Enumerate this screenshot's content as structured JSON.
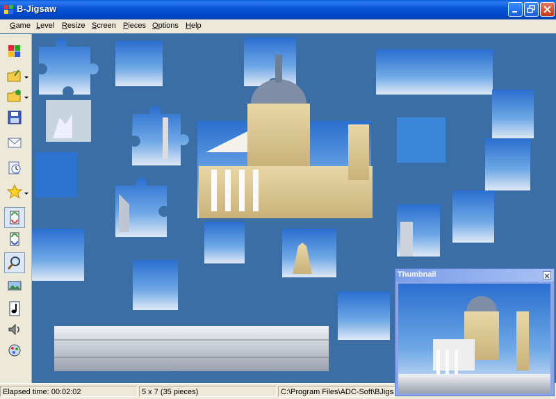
{
  "window": {
    "title": "B-Jigsaw"
  },
  "title_buttons": {
    "minimize": "minimize-icon",
    "maximize": "maximize-icon",
    "close": "close-icon"
  },
  "menu": {
    "items": [
      {
        "ul": "G",
        "rest": "ame"
      },
      {
        "ul": "L",
        "rest": "evel"
      },
      {
        "ul": "R",
        "rest": "esize"
      },
      {
        "ul": "S",
        "rest": "creen"
      },
      {
        "ul": "P",
        "rest": "ieces"
      },
      {
        "ul": "O",
        "rest": "ptions"
      },
      {
        "ul": "H",
        "rest": "elp"
      }
    ]
  },
  "toolbar": {
    "icons": [
      "puzzle-icon",
      "open-folder-icon",
      "open-recent-icon",
      "save-icon",
      "email-icon",
      "timer-icon",
      "favorites-star-icon",
      "shuffle-icon",
      "rotate-icon",
      "zoom-icon",
      "show-picture-icon",
      "music-icon",
      "sound-icon",
      "settings-icon"
    ]
  },
  "status": {
    "elapsed": "Elapsed time: 00:02:02",
    "size": "5 x 7 (35 pieces)",
    "path": "C:\\Program Files\\ADC-Soft\\BJigsaw"
  },
  "thumbnail": {
    "title": "Thumbnail"
  },
  "colors": {
    "desktop": "#3a6ea5",
    "titlebar": "#0a56d8",
    "sky": "#4d8fd6",
    "stone": "#e6d3a0"
  }
}
